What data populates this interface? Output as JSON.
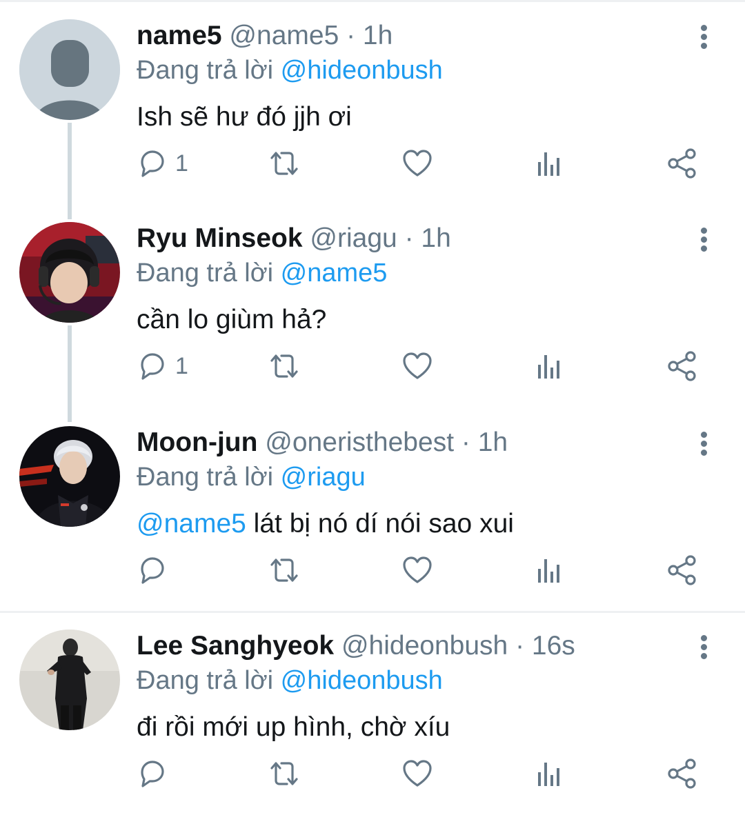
{
  "replying_prefix": "Đang trả lời",
  "colors": {
    "link": "#1d9bf0",
    "secondary": "#657786",
    "divider": "#eef0f2",
    "thread": "#cfd9de"
  },
  "tweets": [
    {
      "name": "name5",
      "handle": "@name5",
      "time": "· 1h",
      "reply_to": "@hideonbush",
      "text": "Ish sẽ hư đó jjh ơi",
      "mention": "",
      "reply_count": "1"
    },
    {
      "name": "Ryu Minseok",
      "handle": "@riagu",
      "time": "· 1h",
      "reply_to": "@name5",
      "text": "cần lo giùm hả?",
      "mention": "",
      "reply_count": "1"
    },
    {
      "name": "Moon-jun",
      "handle": "@oneristhebest",
      "time": "· 1h",
      "reply_to": "@riagu",
      "text": " lát bị nó dí nói sao xui",
      "mention": "@name5",
      "reply_count": ""
    },
    {
      "name": "Lee Sanghyeok",
      "handle": "@hideonbush",
      "time": "· 16s",
      "reply_to": "@hideonbush",
      "text": "đi rồi mới up hình, chờ xíu",
      "mention": "",
      "reply_count": ""
    }
  ]
}
